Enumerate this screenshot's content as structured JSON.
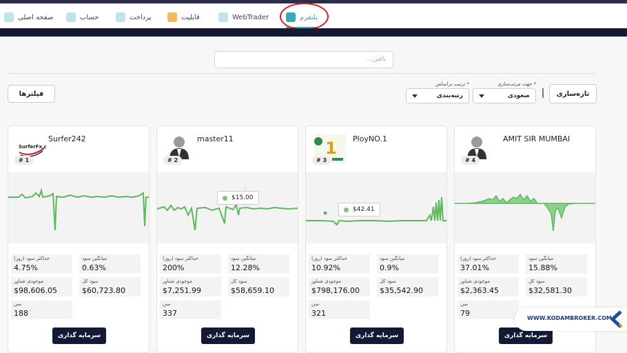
{
  "nav": {
    "home": "صفحه اصلی",
    "account": "حساب",
    "payment": "پرداخت",
    "contracts": "قابلیت",
    "webtrader": "WebTrader",
    "platform": "پلتفرم"
  },
  "search": {
    "placeholder": "یافتن..."
  },
  "filters": {
    "filter_button": "فیلترها",
    "sort_by_label": "* ترتیب براساس",
    "sort_by_value": "رتبه‌بندی",
    "sort_dir_label": "* جهت مرتب‌سازی",
    "sort_dir_value": "صعودی",
    "refresh_button": "تازه‌سازی"
  },
  "stat_labels": {
    "max_daily_profit": "حداکثر سود (روز)",
    "avg_profit": "میانگین سود",
    "balance": "موجودی شناور",
    "total_profit": "سود کل",
    "age": "سن"
  },
  "invest_label": "سرمایه گذاری",
  "cards": [
    {
      "name": "Surfer242",
      "rank": "# 1",
      "max_daily": "4.75%",
      "avg": "0.63%",
      "balance": "$98,606.05",
      "total": "$60,723.80",
      "age": "188",
      "tooltip": ""
    },
    {
      "name": "master11",
      "rank": "# 2",
      "max_daily": "200%",
      "avg": "12.28%",
      "balance": "$7,251.99",
      "total": "$58,659.10",
      "age": "337",
      "tooltip": "$15.00"
    },
    {
      "name": "PloyNO.1",
      "rank": "# 3",
      "max_daily": "10.92%",
      "avg": "0.9%",
      "balance": "$798,176.00",
      "total": "$35,542.90",
      "age": "321",
      "tooltip": "$42.41"
    },
    {
      "name": "AMIT SIR MUMBAI",
      "rank": "# 4",
      "max_daily": "37.01%",
      "avg": "15.88%",
      "balance": "$2,363.45",
      "total": "$32,581.30",
      "age": "79",
      "tooltip": ""
    }
  ],
  "surfer_logo_text": "SurferFx.com",
  "broker_badge": "WWW.KODAMBROKER.COM",
  "colors": {
    "accent": "#3aa8b4",
    "dark": "#141a35",
    "chart": "#5bb85b",
    "highlight": "#d11c1c"
  }
}
